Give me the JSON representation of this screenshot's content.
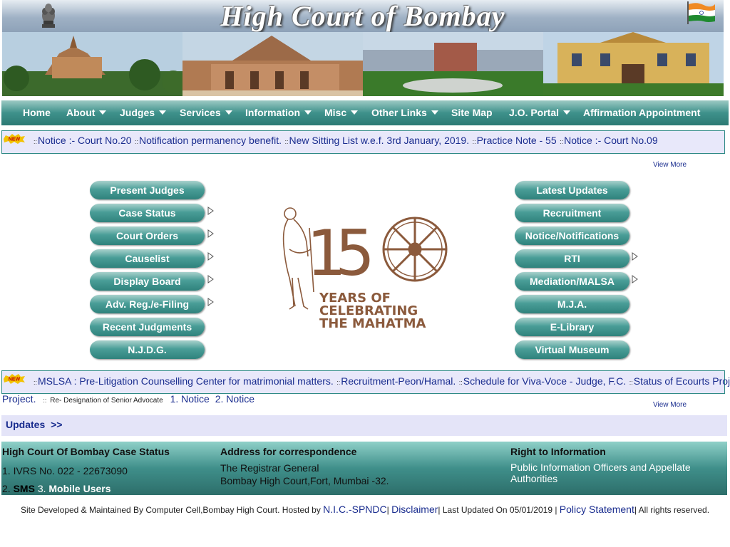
{
  "header": {
    "title": "High Court of Bombay",
    "flag_colors": [
      "#f08a24",
      "#ffffff",
      "#1f8a2f"
    ]
  },
  "nav": [
    {
      "label": "Home",
      "dropdown": false
    },
    {
      "label": "About",
      "dropdown": true
    },
    {
      "label": "Judges",
      "dropdown": true
    },
    {
      "label": "Services",
      "dropdown": true
    },
    {
      "label": "Information",
      "dropdown": true
    },
    {
      "label": "Misc",
      "dropdown": true
    },
    {
      "label": "Other Links",
      "dropdown": true
    },
    {
      "label": "Site Map",
      "dropdown": false
    },
    {
      "label": "J.O. Portal",
      "dropdown": true
    },
    {
      "label": "Affirmation Appointment",
      "dropdown": false
    }
  ],
  "ticker_top": {
    "badge": "NEW",
    "items": [
      "Notice :- Court No.20",
      "Notification permanency benefit.",
      "New Sitting List w.e.f. 3rd January, 2019.",
      "Practice Note - 55",
      "Notice :- Court No.09"
    ],
    "view_more": "View More"
  },
  "left_buttons": [
    {
      "label": "Present Judges",
      "has_submenu": false
    },
    {
      "label": "Case Status",
      "has_submenu": true
    },
    {
      "label": "Court Orders",
      "has_submenu": true
    },
    {
      "label": "Causelist",
      "has_submenu": true
    },
    {
      "label": "Display Board",
      "has_submenu": true
    },
    {
      "label": "Adv. Reg./e-Filing",
      "has_submenu": true
    },
    {
      "label": "Recent Judgments",
      "has_submenu": false
    },
    {
      "label": "N.J.D.G.",
      "has_submenu": false
    }
  ],
  "right_buttons": [
    {
      "label": "Latest Updates",
      "has_submenu": false
    },
    {
      "label": "Recruitment",
      "has_submenu": false
    },
    {
      "label": "Notice/Notifications",
      "has_submenu": false
    },
    {
      "label": "RTI",
      "has_submenu": true
    },
    {
      "label": "Mediation/MALSA",
      "has_submenu": true
    },
    {
      "label": "M.J.A.",
      "has_submenu": false
    },
    {
      "label": "E-Library",
      "has_submenu": false
    },
    {
      "label": "Virtual Museum",
      "has_submenu": false
    }
  ],
  "gandhi_logo": {
    "line1": "YEARS OF",
    "line2": "CELEBRATING",
    "line3": "THE MAHATMA",
    "color": "#8b5a3c"
  },
  "ticker_bottom": {
    "badge": "NEW",
    "items": [
      "MSLSA : Pre-Litigation Counselling Center for matrimonial matters.",
      "Recruitment-Peon/Hamal.",
      "Schedule for Viva-Voce - Judge, F.C.",
      "Status of Ecourts Project."
    ],
    "small_item": "Re- Designation of Senior Advocate",
    "notice_links": [
      "1. Notice",
      "2. Notice"
    ],
    "view_more": "View More"
  },
  "updates": {
    "label": "Updates",
    "arrows": ">>"
  },
  "footer": {
    "col1_title": "High Court Of Bombay Case Status",
    "col1_line1": "1. IVRS No. 022 - 22673090",
    "col1_num2": "2.",
    "col1_sms": "SMS",
    "col1_num3": "3.",
    "col1_mobile": "Mobile Users",
    "col2_title": "Address for correspondence",
    "col2_line1": "The Registrar General",
    "col2_line2": "Bombay High Court,Fort, Mumbai -32.",
    "col3_title": "Right to Information",
    "col3_text": "Public Information Officers and Appellate Authorities"
  },
  "bottom": {
    "prefix": "Site Developed & Maintained By Computer Cell,Bombay High Court. Hosted by",
    "nic": "N.I.C.-SPNDC",
    "disclaimer": "Disclaimer",
    "updated": "Last Updated On 05/01/2019 |",
    "policy": "Policy Statement",
    "rights": "All rights reserved."
  }
}
